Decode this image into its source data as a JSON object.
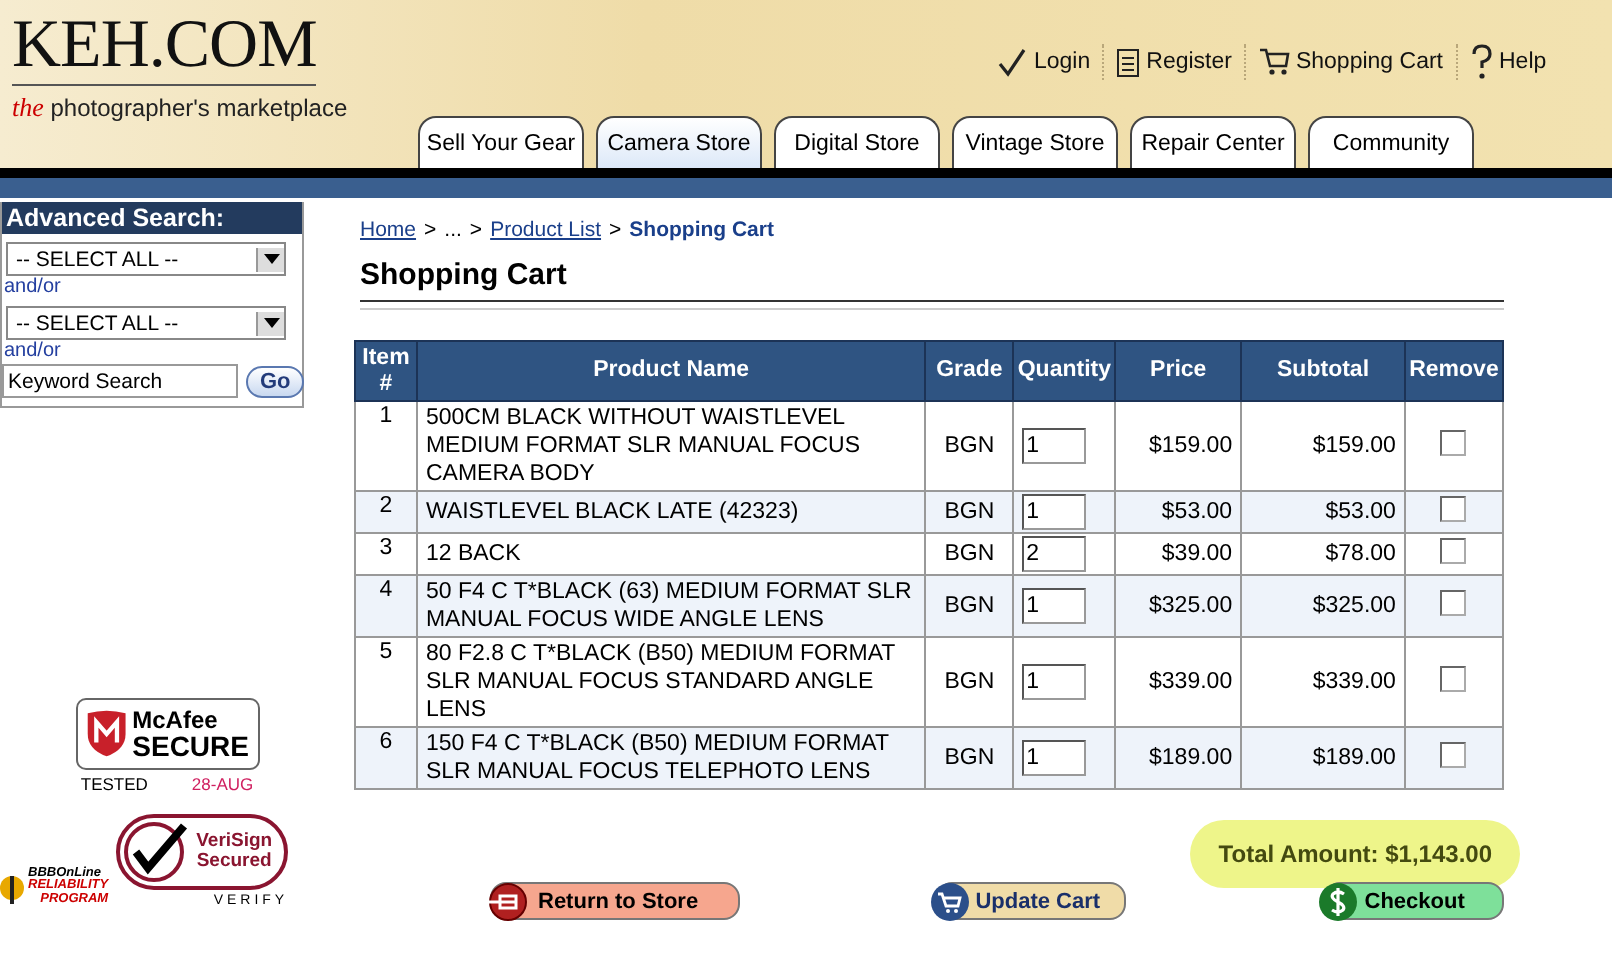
{
  "header": {
    "logo": "KEH.COM",
    "tagline_em": "the",
    "tagline": "photographer's marketplace",
    "links": [
      {
        "label": "Login",
        "kind": "check"
      },
      {
        "label": "Register",
        "kind": "clipboard"
      },
      {
        "label": "Shopping Cart",
        "kind": "cart"
      },
      {
        "label": "Help",
        "kind": "help"
      }
    ],
    "tabs": [
      {
        "label": "Sell Your Gear",
        "selected": false
      },
      {
        "label": "Camera Store",
        "selected": true
      },
      {
        "label": "Digital Store",
        "selected": false
      },
      {
        "label": "Vintage Store",
        "selected": false
      },
      {
        "label": "Repair Center",
        "selected": false
      },
      {
        "label": "Community",
        "selected": false
      }
    ]
  },
  "sidebar": {
    "title": "Advanced Search:",
    "filters": [
      {
        "value": "-- SELECT ALL --",
        "connector": "and/or"
      },
      {
        "value": "-- SELECT ALL --",
        "connector": "and/or"
      }
    ],
    "keyword": "Keyword Search",
    "go": "Go"
  },
  "badges": {
    "mcafee": {
      "brand": "McAfee",
      "word": "SECURE",
      "tested": "TESTED",
      "date": "28-AUG"
    },
    "bbb": {
      "line1": "BBBOnLine",
      "line2": "RELIABILITY",
      "line3": "PROGRAM"
    },
    "verisign": {
      "line1": "VeriSign",
      "line2": "Secured",
      "verify": "VERIFY"
    }
  },
  "breadcrumb": [
    {
      "label": "Home",
      "kind": "link"
    },
    {
      "label": ">",
      "kind": "sep"
    },
    {
      "label": "...",
      "kind": "text"
    },
    {
      "label": ">",
      "kind": "sep"
    },
    {
      "label": "Product List",
      "kind": "link"
    },
    {
      "label": ">",
      "kind": "sep"
    },
    {
      "label": "Shopping Cart",
      "kind": "current"
    }
  ],
  "page_title": "Shopping Cart",
  "table": {
    "columns": [
      "Item #",
      "Product Name",
      "Grade",
      "Quantity",
      "Price",
      "Subtotal",
      "Remove"
    ],
    "rows": [
      {
        "item": "1",
        "name": "500CM BLACK WITHOUT WAISTLEVEL MEDIUM FORMAT SLR MANUAL FOCUS CAMERA BODY",
        "grade": "BGN",
        "quantity": "1",
        "price": "$159.00",
        "subtotal": "$159.00",
        "remove": false
      },
      {
        "item": "2",
        "name": "WAISTLEVEL BLACK LATE (42323)",
        "grade": "BGN",
        "quantity": "1",
        "price": "$53.00",
        "subtotal": "$53.00",
        "remove": false
      },
      {
        "item": "3",
        "name": "12 BACK",
        "grade": "BGN",
        "quantity": "2",
        "price": "$39.00",
        "subtotal": "$78.00",
        "remove": false
      },
      {
        "item": "4",
        "name": "50 F4 C T*BLACK (63) MEDIUM FORMAT SLR MANUAL FOCUS WIDE ANGLE LENS",
        "grade": "BGN",
        "quantity": "1",
        "price": "$325.00",
        "subtotal": "$325.00",
        "remove": false
      },
      {
        "item": "5",
        "name": "80 F2.8 C T*BLACK (B50) MEDIUM FORMAT SLR MANUAL FOCUS STANDARD ANGLE LENS",
        "grade": "BGN",
        "quantity": "1",
        "price": "$339.00",
        "subtotal": "$339.00",
        "remove": false
      },
      {
        "item": "6",
        "name": "150 F4 C T*BLACK (B50) MEDIUM FORMAT SLR MANUAL FOCUS TELEPHOTO LENS",
        "grade": "BGN",
        "quantity": "1",
        "price": "$189.00",
        "subtotal": "$189.00",
        "remove": false
      }
    ]
  },
  "total": "Total Amount: $1,143.00",
  "buttons": [
    {
      "label": "Return to Store",
      "kind": "return"
    },
    {
      "label": "Update Cart",
      "kind": "update"
    },
    {
      "label": "Checkout",
      "kind": "checkout"
    }
  ]
}
